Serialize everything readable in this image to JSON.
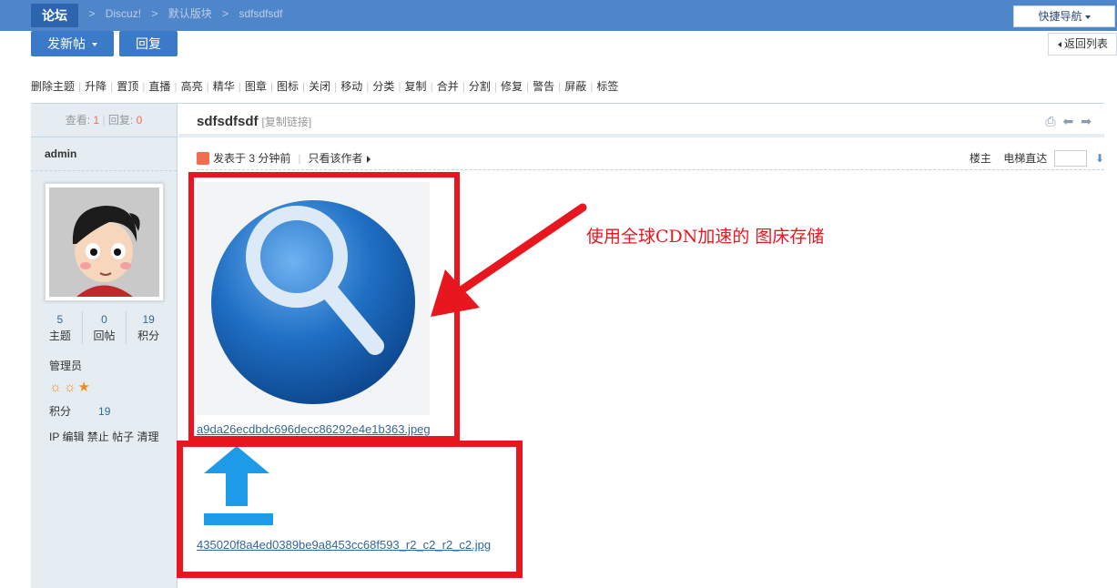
{
  "header": {
    "logo": "论坛",
    "breadcrumbs": [
      "论坛",
      ">",
      "Discuz!",
      ">",
      "默认版块",
      ">",
      "sdfsdfsdf"
    ],
    "quick_nav": "快捷导航"
  },
  "actions": {
    "new_post": "发新帖",
    "reply": "回复",
    "back_to_list": "返回列表"
  },
  "mod_tools": [
    "删除主题",
    "升降",
    "置顶",
    "直播",
    "高亮",
    "精华",
    "图章",
    "图标",
    "关闭",
    "移动",
    "分类",
    "复制",
    "合并",
    "分割",
    "修复",
    "警告",
    "屏蔽",
    "标签"
  ],
  "thread_stats": {
    "views_label": "查看:",
    "views": "1",
    "replies_label": "回复:",
    "replies": "0"
  },
  "author": {
    "name": "admin",
    "stats": [
      {
        "value": "5",
        "label": "主题"
      },
      {
        "value": "0",
        "label": "回帖"
      },
      {
        "value": "19",
        "label": "积分"
      }
    ],
    "role": "管理员",
    "stars": "☼☼★",
    "points_label": "积分",
    "points": "19",
    "admin_links": "IP 编辑 禁止 帖子 清理"
  },
  "post": {
    "title": "sdfsdfsdf",
    "copy_link": "[复制链接]",
    "posted": "发表于 3 分钟前",
    "only_author": "只看该作者",
    "floor": "楼主",
    "jump_label": "电梯直达",
    "attachment1": "a9da26ecdbdc696decc86292e4e1b363.jpeg",
    "attachment2": "435020f8a4ed0389be9a8453cc68f593_r2_c2_r2_c2.jpg"
  },
  "annotation": "使用全球CDN加速的 图床存储",
  "colors": {
    "accent": "#4f85c9",
    "annotation": "#e8161e",
    "link": "#336699"
  }
}
